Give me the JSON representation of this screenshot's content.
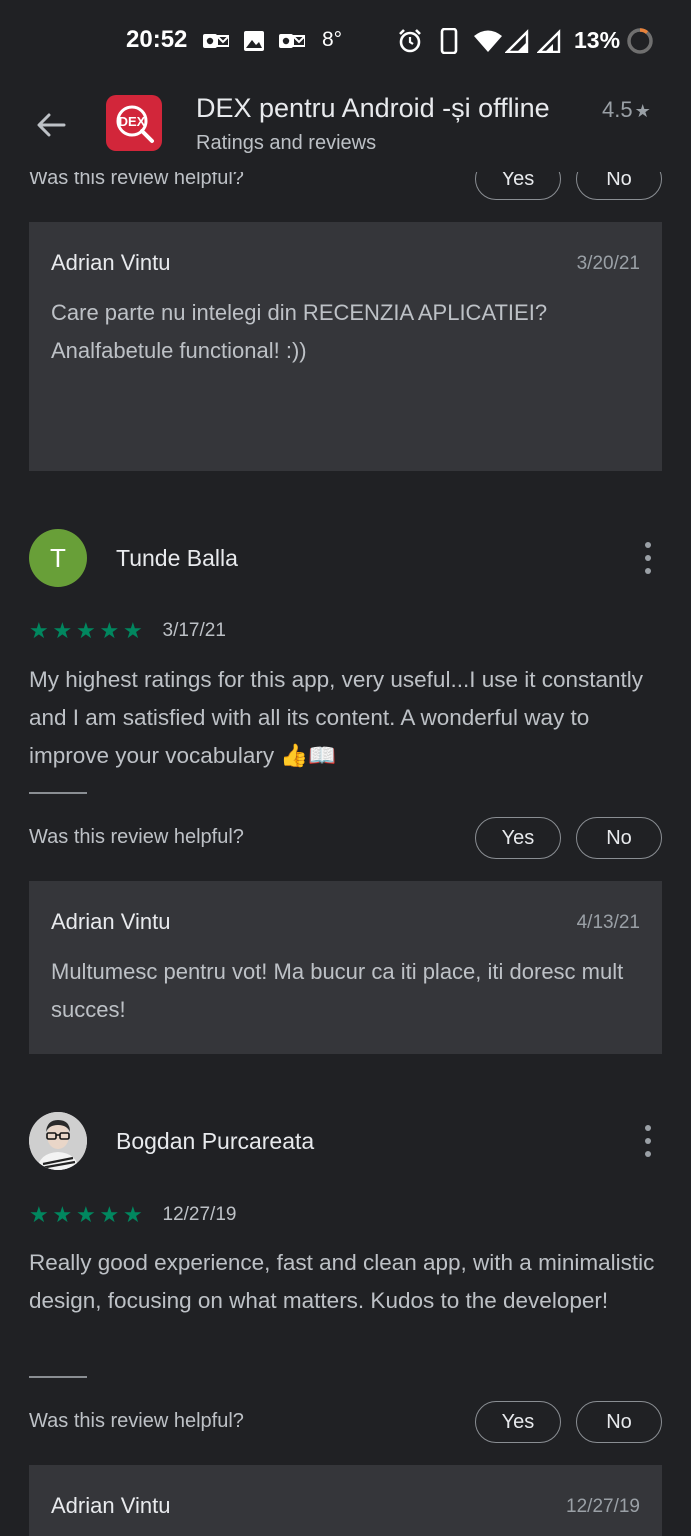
{
  "status_bar": {
    "time": "20:52",
    "temperature": "8°",
    "battery": "13%",
    "icons": [
      "outlook-icon",
      "gallery-icon",
      "outlook-icon",
      "alarm-icon",
      "vibrate-icon",
      "wifi-icon",
      "signal-icon",
      "signal-roaming-icon",
      "battery-saver-icon"
    ]
  },
  "header": {
    "app_icon_text": "DEX",
    "title": "DEX pentru Android -și offline",
    "rating": "4.5",
    "subtitle": "Ratings and reviews"
  },
  "top_helpful": {
    "question": "Was this review helpful?",
    "yes": "Yes",
    "no": "No"
  },
  "reviews": [
    {
      "reply": {
        "author": "Adrian Vintu",
        "date": "3/20/21",
        "text": "Care parte nu intelegi din RECENZIA APLICATIEI? Analfabetule functional! :))"
      }
    },
    {
      "reviewer": "Tunde Balla",
      "avatar_letter": "T",
      "avatar_color": "#689f38",
      "stars": 5,
      "date": "3/17/21",
      "text": "My highest ratings for this app, very useful...I use it constantly and I am satisfied with all its content. A wonderful way to improve your vocabulary 👍📖",
      "helpful": {
        "question": "Was this review helpful?",
        "yes": "Yes",
        "no": "No"
      },
      "reply": {
        "author": "Adrian Vintu",
        "date": "4/13/21",
        "text": "Multumesc pentru vot! Ma bucur ca iti place, iti doresc mult succes!"
      }
    },
    {
      "reviewer": "Bogdan Purcareata",
      "stars": 5,
      "date": "12/27/19",
      "text": "Really good experience, fast and clean app, with a minimalistic design, focusing on what matters. Kudos to the developer!",
      "helpful": {
        "question": "Was this review helpful?",
        "yes": "Yes",
        "no": "No"
      },
      "reply": {
        "author": "Adrian Vintu",
        "date": "12/27/19"
      }
    }
  ],
  "colors": {
    "background": "#202124",
    "reply_box": "#35363a",
    "star_green": "#01875f",
    "app_icon_red": "#d2263a"
  }
}
